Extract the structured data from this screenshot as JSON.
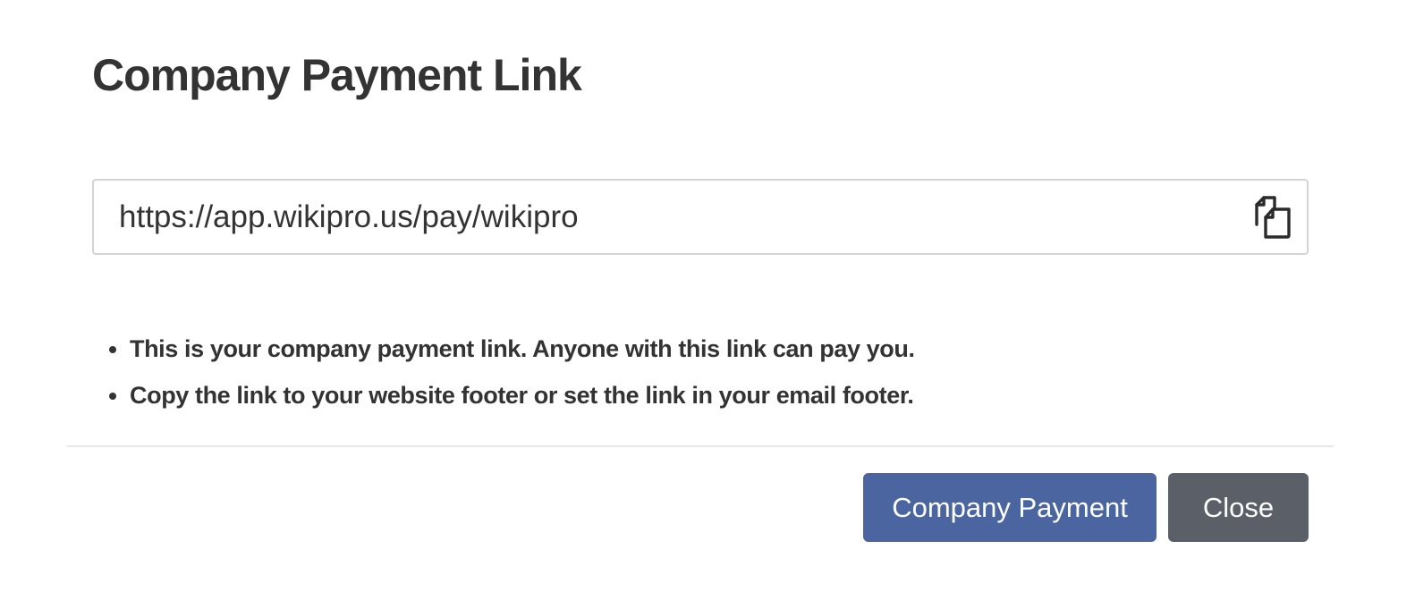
{
  "dialog": {
    "title": "Company Payment Link",
    "link_value": "https://app.wikipro.us/pay/wikipro",
    "copy_icon": "copy-icon",
    "notes": [
      "This is your company payment link. Anyone with this link can pay you.",
      "Copy the link to your website footer or set the link in your email footer."
    ],
    "primary_button_label": "Company Payment",
    "close_button_label": "Close"
  },
  "colors": {
    "primary_button": "#4a65a0",
    "close_button": "#5b6068",
    "text": "#333333",
    "input_border": "#d4d4d4"
  }
}
